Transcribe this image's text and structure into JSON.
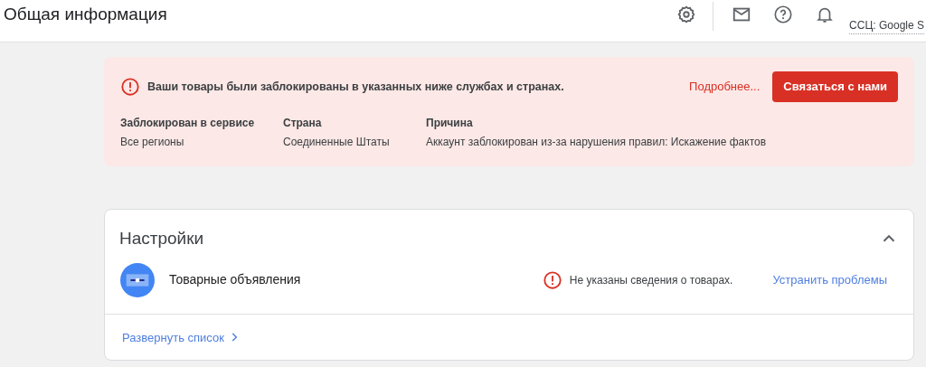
{
  "header": {
    "title": "Общая информация",
    "account": "ССЦ: Google S"
  },
  "alert": {
    "message": "Ваши товары были заблокированы в указанных ниже службах и странах.",
    "link": "Подробнее...",
    "button": "Связаться с нами",
    "columns": [
      {
        "heading": "Заблокирован в сервисе",
        "value": "Все регионы"
      },
      {
        "heading": "Страна",
        "value": "Соединенные Штаты"
      },
      {
        "heading": "Причина",
        "value": "Аккаунт заблокирован из-за нарушения правил: Искажение фактов"
      }
    ]
  },
  "settings": {
    "title": "Настройки",
    "expanded": true,
    "items": [
      {
        "name": "Товарные объявления",
        "issue": "Не указаны сведения о товарах.",
        "action": "Устранить проблемы"
      }
    ],
    "footer_link": "Развернуть список"
  }
}
